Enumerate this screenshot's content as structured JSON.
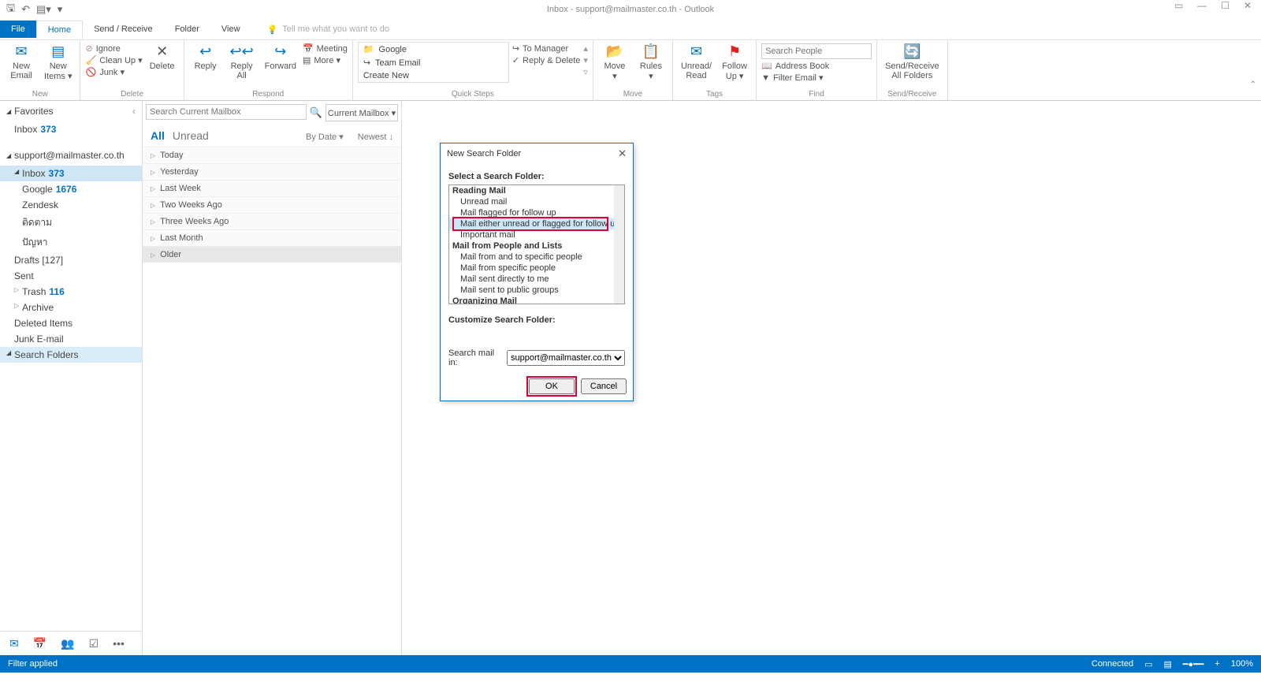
{
  "title": "Inbox - support@mailmaster.co.th - Outlook",
  "tabs": {
    "file": "File",
    "home": "Home",
    "sendrecv": "Send / Receive",
    "folder": "Folder",
    "view": "View",
    "tellme": "Tell me what you want to do"
  },
  "ribbon": {
    "new": {
      "email": "New\nEmail",
      "items": "New\nItems ▾",
      "label": "New"
    },
    "delete": {
      "ignore": "Ignore",
      "cleanup": "Clean Up ▾",
      "junk": "Junk ▾",
      "delete": "Delete",
      "label": "Delete"
    },
    "respond": {
      "reply": "Reply",
      "replyall": "Reply\nAll",
      "forward": "Forward",
      "meeting": "Meeting",
      "more": "More ▾",
      "label": "Respond"
    },
    "quicksteps": {
      "google": "Google",
      "team": "Team Email",
      "create": "Create New",
      "tomgr": "To Manager",
      "replydel": "Reply & Delete",
      "label": "Quick Steps"
    },
    "move": {
      "move": "Move\n▾",
      "rules": "Rules\n▾",
      "label": "Move"
    },
    "tags": {
      "unread": "Unread/\nRead",
      "follow": "Follow\nUp ▾",
      "label": "Tags"
    },
    "find": {
      "search_placeholder": "Search People",
      "address": "Address Book",
      "filter": "Filter Email ▾",
      "label": "Find"
    },
    "sr": {
      "btn": "Send/Receive\nAll Folders",
      "label": "Send/Receive"
    }
  },
  "nav": {
    "favorites": "Favorites",
    "inbox": "Inbox",
    "inbox_count": "373",
    "account": "support@mailmaster.co.th",
    "folders": {
      "inbox": "Inbox",
      "inbox_c": "373",
      "google": "Google",
      "google_c": "1676",
      "zendesk": "Zendesk",
      "th1": "ติดตาม",
      "th2": "ปัญหา",
      "drafts": "Drafts [127]",
      "sent": "Sent",
      "trash": "Trash",
      "trash_c": "116",
      "archive": "Archive",
      "deleted": "Deleted Items",
      "junk": "Junk E-mail",
      "search": "Search Folders"
    }
  },
  "list": {
    "search_placeholder": "Search Current Mailbox",
    "scope": "Current Mailbox ▾",
    "all": "All",
    "unread": "Unread",
    "bydate": "By Date ▾",
    "newest": "Newest ↓",
    "groups": [
      "Today",
      "Yesterday",
      "Last Week",
      "Two Weeks Ago",
      "Three Weeks Ago",
      "Last Month",
      "Older"
    ]
  },
  "dialog": {
    "title": "New Search Folder",
    "select": "Select a Search Folder:",
    "cat1": "Reading Mail",
    "o1": "Unread mail",
    "o2": "Mail flagged for follow up",
    "o3": "Mail either unread or flagged for follow up",
    "o4": "Important mail",
    "cat2": "Mail from People and Lists",
    "o5": "Mail from and to specific people",
    "o6": "Mail from specific people",
    "o7": "Mail sent directly to me",
    "o8": "Mail sent to public groups",
    "cat3": "Organizing Mail",
    "customize": "Customize Search Folder:",
    "searchin": "Search mail in:",
    "account": "support@mailmaster.co.th",
    "ok": "OK",
    "cancel": "Cancel"
  },
  "status": {
    "filter": "Filter applied",
    "connected": "Connected",
    "zoom": "100%"
  }
}
